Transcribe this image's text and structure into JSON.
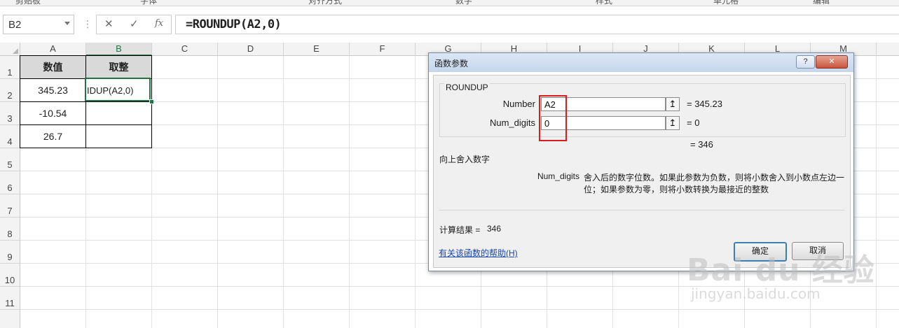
{
  "ribbon": {
    "groups": [
      "剪贴板",
      "字体",
      "对齐方式",
      "数字",
      "样式",
      "单元格",
      "编辑"
    ]
  },
  "formula_bar": {
    "name_box": "B2",
    "cancel_icon": "✕",
    "enter_icon": "✓",
    "fx_icon": "fx",
    "formula": "=ROUNDUP(A2,0)"
  },
  "grid": {
    "columns": [
      "A",
      "B",
      "C",
      "D",
      "E",
      "F",
      "G",
      "H",
      "I",
      "J",
      "K",
      "L",
      "M"
    ],
    "rows": [
      "1",
      "2",
      "3",
      "4",
      "5",
      "6",
      "7",
      "8",
      "9",
      "10",
      "11"
    ],
    "selected_column": "B",
    "cells": {
      "A1": "数值",
      "B1": "取整",
      "A2": "345.23",
      "B2": "IDUP(A2,0)",
      "A3": "-10.54",
      "A4": "26.7"
    }
  },
  "dialog": {
    "title": "函数参数",
    "help_btn": "?",
    "close_btn": "✕",
    "function_name": "ROUNDUP",
    "args": [
      {
        "label": "Number",
        "value": "A2",
        "ref_icon": "↥",
        "result": "=  345.23"
      },
      {
        "label": "Num_digits",
        "value": "0",
        "ref_icon": "↥",
        "result": "=  0"
      }
    ],
    "function_result": "=  346",
    "function_desc": "向上舍入数字",
    "arg_desc_label": "Num_digits",
    "arg_desc_line1": "舍入后的数字位数。如果此参数为负数，则将小数舍入到小数点左边一",
    "arg_desc_line2": "位；如果参数为零，则将小数转换为最接近的整数",
    "calc_result_label": "计算结果 =",
    "calc_result_value": "346",
    "help_link": "有关该函数的帮助(H)",
    "ok_label": "确定",
    "cancel_label": "取消"
  },
  "watermark": {
    "brand": "Bai du 经验",
    "url": "jingyan.baidu.com"
  }
}
